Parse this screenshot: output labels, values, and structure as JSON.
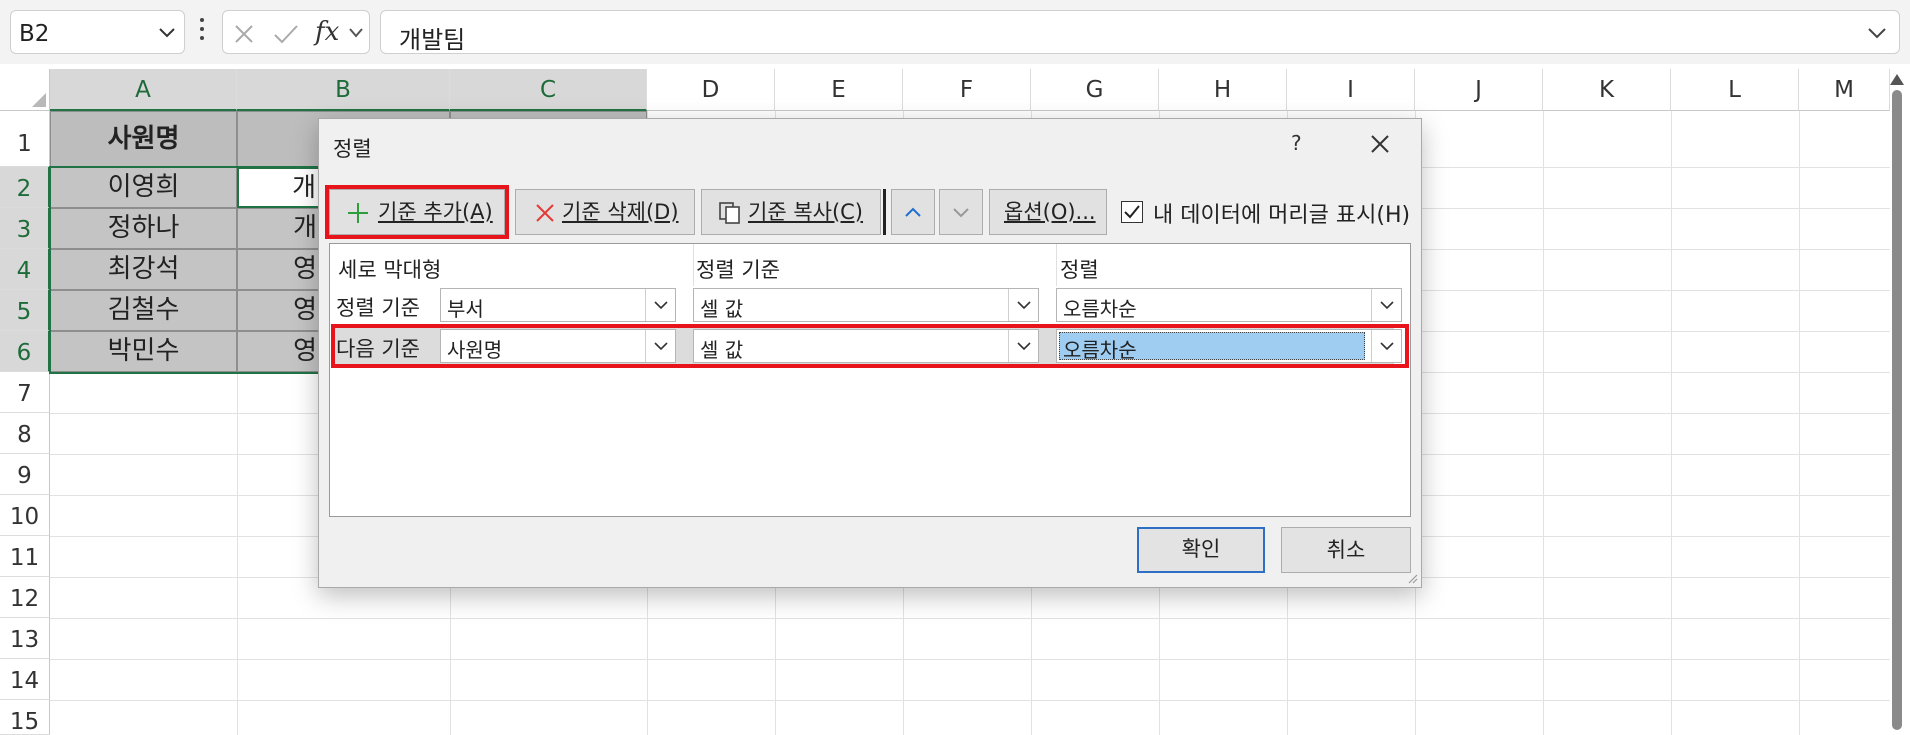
{
  "formula_bar": {
    "name_box": "B2",
    "cancel_icon": "x-icon",
    "enter_icon": "check-icon",
    "fx_label": "fx",
    "content": "개발팀"
  },
  "sheet": {
    "columns": [
      "A",
      "B",
      "C",
      "D",
      "E",
      "F",
      "G",
      "H",
      "I",
      "J",
      "K",
      "L",
      "M"
    ],
    "rows": [
      "1",
      "2",
      "3",
      "4",
      "5",
      "6",
      "7",
      "8",
      "9",
      "10",
      "11",
      "12",
      "13",
      "14",
      "15"
    ],
    "header_a1": "사원명",
    "names": [
      "이영희",
      "정하나",
      "최강석",
      "김철수",
      "박민수"
    ],
    "col_b_partial": [
      "개",
      "개",
      "영",
      "영",
      "영"
    ],
    "selection_color": "#217346"
  },
  "dialog": {
    "title": "정렬",
    "help": "?",
    "toolbar": {
      "add_level": "기준 추가(A)",
      "delete_level": "기준 삭제(D)",
      "copy_level": "기준 복사(C)",
      "options": "옵션(O)...",
      "has_headers_label": "내 데이터에 머리글 표시(H)",
      "has_headers_checked": true
    },
    "columns_header": {
      "column": "세로 막대형",
      "sort_on": "정렬 기준",
      "order": "정렬"
    },
    "levels": [
      {
        "label": "정렬 기준",
        "column": "부서",
        "sort_on": "셀 값",
        "order": "오름차순"
      },
      {
        "label": "다음 기준",
        "column": "사원명",
        "sort_on": "셀 값",
        "order": "오름차순"
      }
    ],
    "ok": "확인",
    "cancel": "취소",
    "highlight_color": "#e8141c"
  }
}
